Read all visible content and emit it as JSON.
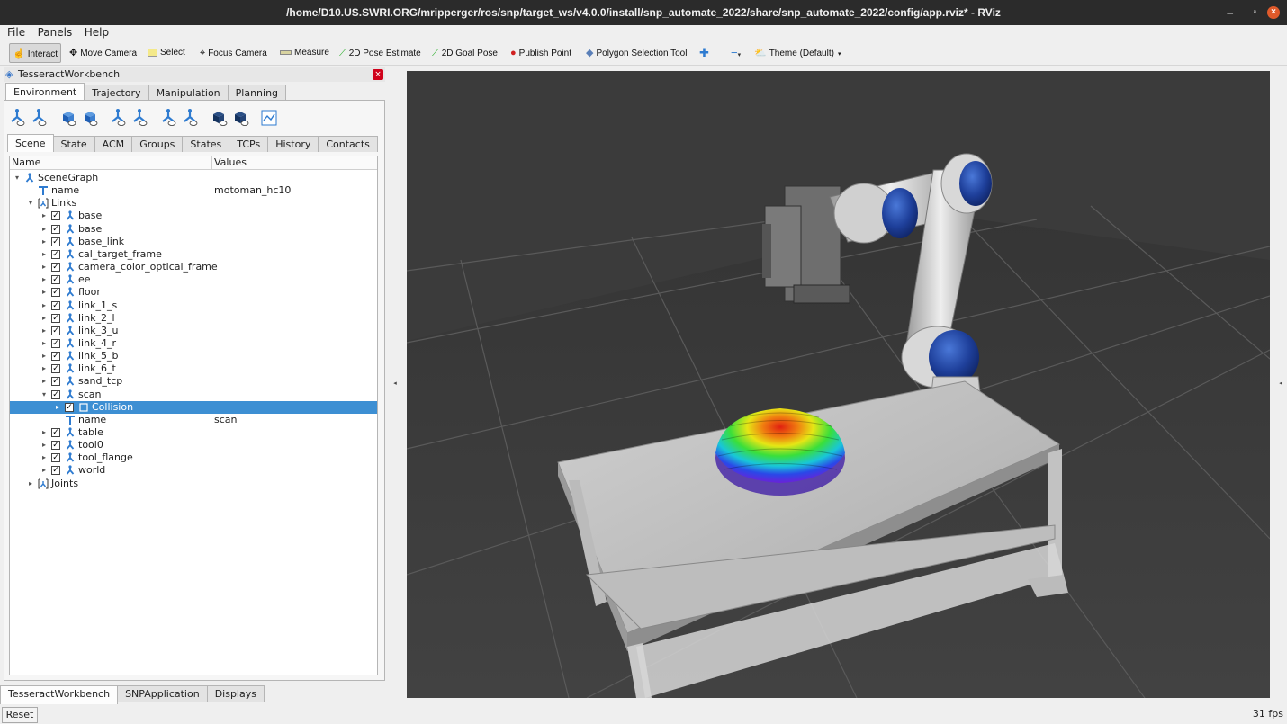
{
  "window": {
    "title": "/home/D10.US.SWRI.ORG/mripperger/ros/snp/target_ws/v4.0.0/install/snp_automate_2022/share/snp_automate_2022/config/app.rviz* - RViz"
  },
  "menu": [
    "File",
    "Panels",
    "Help"
  ],
  "toolbar": {
    "interact": "Interact",
    "move_camera": "Move Camera",
    "select": "Select",
    "focus_camera": "Focus Camera",
    "measure": "Measure",
    "pose_estimate": "2D Pose Estimate",
    "goal_pose": "2D Goal Pose",
    "publish_point": "Publish Point",
    "polygon_tool": "Polygon Selection Tool",
    "theme": "Theme (Default)"
  },
  "dock": {
    "title": "TesseractWorkbench",
    "main_tabs": [
      "Environment",
      "Trajectory",
      "Manipulation",
      "Planning"
    ],
    "sub_tabs": [
      "Scene",
      "State",
      "ACM",
      "Groups",
      "States",
      "TCPs",
      "History",
      "Contacts"
    ],
    "columns": {
      "name": "Name",
      "values": "Values"
    }
  },
  "tree": {
    "scene_graph": "SceneGraph",
    "name_key": "name",
    "name_value": "motoman_hc10",
    "links_label": "Links",
    "links": [
      "base",
      "base",
      "base_link",
      "cal_target_frame",
      "camera_color_optical_frame",
      "ee",
      "floor",
      "link_1_s",
      "link_2_l",
      "link_3_u",
      "link_4_r",
      "link_5_b",
      "link_6_t",
      "sand_tcp",
      "scan"
    ],
    "scan_children": {
      "collision": "Collision",
      "name_key": "name",
      "name_value": "scan"
    },
    "links_after": [
      "table",
      "tool0",
      "tool_flange",
      "world"
    ],
    "joints_label": "Joints"
  },
  "bottom_tabs": [
    "TesseractWorkbench",
    "SNPApplication",
    "Displays"
  ],
  "status": {
    "reset": "Reset",
    "fps": "31 fps"
  },
  "colors": {
    "selection": "#3d8fd3",
    "viewport_bg": "#3e3e3e",
    "close_red": "#d0021b",
    "link_icon": "#2e7bd0"
  }
}
